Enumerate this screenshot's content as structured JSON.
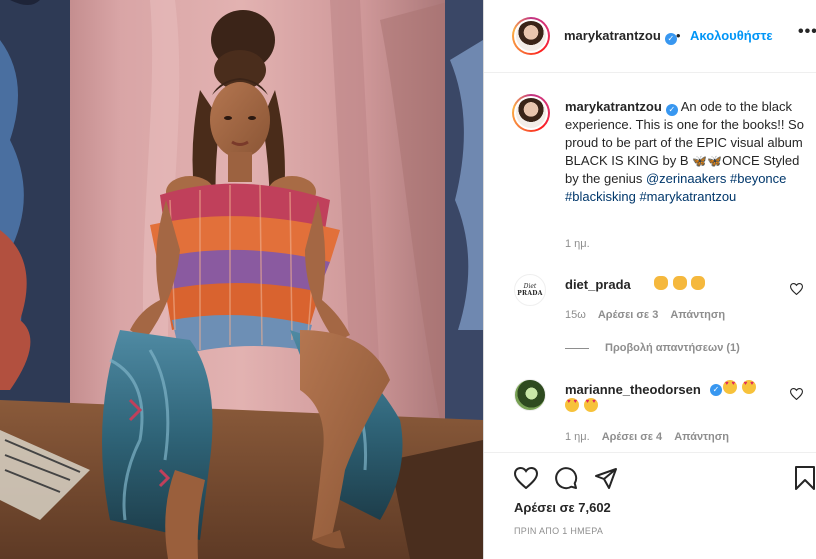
{
  "post": {
    "author": "marykatrantzou",
    "follow_label": "Ακολουθήστε",
    "more_label": "•••",
    "separator": "•",
    "caption_user": "marykatrantzou",
    "caption_line1": "An ode to the black experience. This is one for the books!! So proud to be part of the EPIC visual album BLACK IS KING by B",
    "caption_line2": "ONCE Styled by the genius",
    "caption_mention": "@zerinaakers",
    "caption_tags": [
      "#beyonce",
      "#blackisking",
      "#marykatrantzou"
    ],
    "caption_time": "1 ημ.",
    "likes": "Αρέσει σε 7,602",
    "posted": "ΠΡΙΝ ΑΠΟ 1 ΗΜΕΡΑ"
  },
  "comments": [
    {
      "user": "diet_prada",
      "avatar_text_1": "Diet",
      "avatar_text_2": "PRADA",
      "emojis": [
        "clap",
        "clap",
        "clap"
      ],
      "time": "15ω",
      "likes": "Αρέσει σε 3",
      "reply": "Απάντηση",
      "view_replies": "Προβολή απαντήσεων (1)"
    },
    {
      "user": "marianne_theodorsen",
      "emojis": [
        "heart-eyes",
        "heart-eyes",
        "heart-eyes",
        "heart-eyes"
      ],
      "time": "1 ημ.",
      "likes": "Αρέσει σε 4",
      "reply": "Απάντηση"
    }
  ],
  "icons": {
    "verified": "verified-badge-icon",
    "like": "heart-icon",
    "comment": "comment-icon",
    "share": "share-icon",
    "save": "bookmark-icon"
  },
  "colors": {
    "link": "#0095f6",
    "tag": "#00376b",
    "verified": "#3897f0",
    "muted": "#8e8e8e"
  }
}
